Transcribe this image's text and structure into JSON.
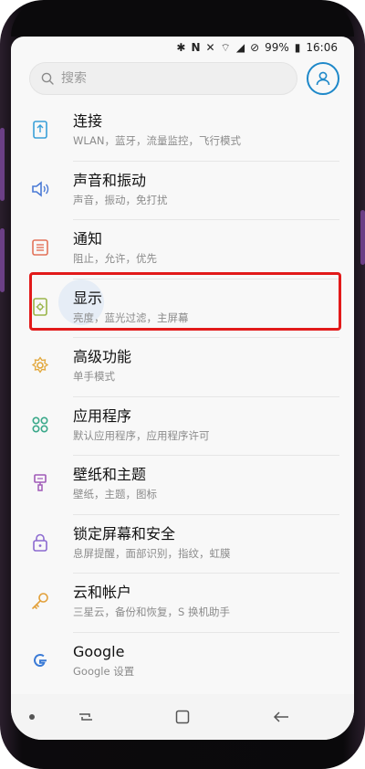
{
  "status_bar": {
    "battery": "99%",
    "time": "16:06"
  },
  "search": {
    "placeholder": "搜索"
  },
  "settings": [
    {
      "title": "连接",
      "subtitle": "WLAN，蓝牙，流量监控，飞行模式",
      "icon": "connections-icon",
      "color": "#3aa0d8"
    },
    {
      "title": "声音和振动",
      "subtitle": "声音，振动，免打扰",
      "icon": "speaker-icon",
      "color": "#4a7ad6"
    },
    {
      "title": "通知",
      "subtitle": "阻止，允许，优先",
      "icon": "notification-icon",
      "color": "#e3735a"
    },
    {
      "title": "显示",
      "subtitle": "亮度，蓝光过滤，主屏幕",
      "icon": "display-icon",
      "color": "#9ab54a"
    },
    {
      "title": "高级功能",
      "subtitle": "单手模式",
      "icon": "advanced-features-icon",
      "color": "#e2a73a"
    },
    {
      "title": "应用程序",
      "subtitle": "默认应用程序，应用程序许可",
      "icon": "apps-icon",
      "color": "#3aa88a"
    },
    {
      "title": "壁纸和主题",
      "subtitle": "壁纸，主题，图标",
      "icon": "brush-icon",
      "color": "#a05ab8"
    },
    {
      "title": "锁定屏幕和安全",
      "subtitle": "息屏提醒，面部识别，指纹，虹膜",
      "icon": "lock-icon",
      "color": "#8c6ad0"
    },
    {
      "title": "云和帐户",
      "subtitle": "三星云，备份和恢复，S 换机助手",
      "icon": "key-icon",
      "color": "#e2a03a"
    },
    {
      "title": "Google",
      "subtitle": "Google 设置",
      "icon": "google-icon",
      "color": "#3a7ad6"
    }
  ],
  "colors": {
    "highlight": "#e21a1a",
    "accent": "#1e88c9"
  }
}
